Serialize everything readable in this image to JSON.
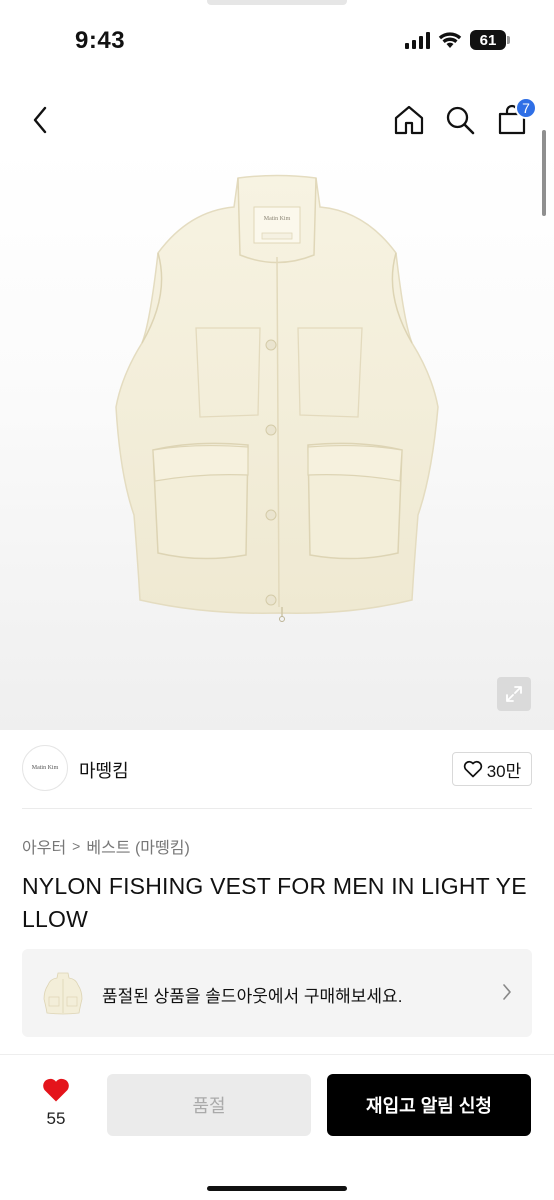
{
  "status_bar": {
    "time": "9:43",
    "battery_level": "61",
    "icons": [
      "signal-icon",
      "wifi-icon",
      "battery-icon"
    ]
  },
  "header": {
    "icons": [
      "back-icon",
      "home-icon",
      "search-icon",
      "cart-icon"
    ],
    "cart_count": "7",
    "badge_color": "#2f6fe6"
  },
  "product_image": {
    "subject": "cream nylon fishing vest",
    "expand_icon": "expand-icon",
    "vest_label_text": "Matin Kim"
  },
  "brand": {
    "logo_text": "Matin Kim",
    "name": "마뗑킴",
    "likes": "30만"
  },
  "breadcrumb": {
    "category": "아우터",
    "separator": ">",
    "subcategory": "베스트 (마뗑킴)"
  },
  "product": {
    "title": "NYLON FISHING VEST FOR MEN IN LIGHT YELLOW"
  },
  "soldout_banner": {
    "text": "품절된 상품을 솔드아웃에서 구매해보세요."
  },
  "bottom_bar": {
    "wish_count": "55",
    "heart_color": "#e4141b",
    "soldout_label": "품절",
    "restock_label": "재입고 알림 신청"
  }
}
